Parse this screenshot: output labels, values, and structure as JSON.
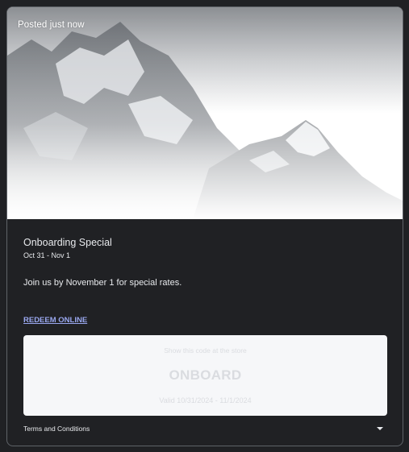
{
  "card": {
    "posted": "Posted just now",
    "title": "Onboarding Special",
    "dates": "Oct 31 - Nov 1",
    "description": "Join us by November 1 for special rates.",
    "redeem_link": "REDEEM ONLINE",
    "code_box": {
      "hint": "Show this code at the store",
      "code": "ONBOARD",
      "valid": "Valid 10/31/2024 - 11/1/2024"
    },
    "terms_label": "Terms and Conditions",
    "hero_image": "snowy-mountain-photo"
  },
  "colors": {
    "background": "#202124",
    "border": "#5f6368",
    "link": "#9aa8f0",
    "code_box_bg": "#f6f7f9"
  }
}
